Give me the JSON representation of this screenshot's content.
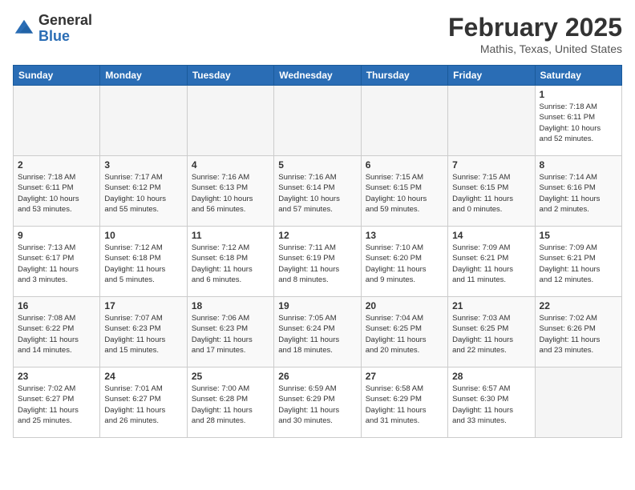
{
  "logo": {
    "general": "General",
    "blue": "Blue"
  },
  "title": "February 2025",
  "subtitle": "Mathis, Texas, United States",
  "weekdays": [
    "Sunday",
    "Monday",
    "Tuesday",
    "Wednesday",
    "Thursday",
    "Friday",
    "Saturday"
  ],
  "weeks": [
    [
      {
        "day": "",
        "info": ""
      },
      {
        "day": "",
        "info": ""
      },
      {
        "day": "",
        "info": ""
      },
      {
        "day": "",
        "info": ""
      },
      {
        "day": "",
        "info": ""
      },
      {
        "day": "",
        "info": ""
      },
      {
        "day": "1",
        "info": "Sunrise: 7:18 AM\nSunset: 6:11 PM\nDaylight: 10 hours\nand 52 minutes."
      }
    ],
    [
      {
        "day": "2",
        "info": "Sunrise: 7:18 AM\nSunset: 6:11 PM\nDaylight: 10 hours\nand 53 minutes."
      },
      {
        "day": "3",
        "info": "Sunrise: 7:17 AM\nSunset: 6:12 PM\nDaylight: 10 hours\nand 55 minutes."
      },
      {
        "day": "4",
        "info": "Sunrise: 7:16 AM\nSunset: 6:13 PM\nDaylight: 10 hours\nand 56 minutes."
      },
      {
        "day": "5",
        "info": "Sunrise: 7:16 AM\nSunset: 6:14 PM\nDaylight: 10 hours\nand 57 minutes."
      },
      {
        "day": "6",
        "info": "Sunrise: 7:15 AM\nSunset: 6:15 PM\nDaylight: 10 hours\nand 59 minutes."
      },
      {
        "day": "7",
        "info": "Sunrise: 7:15 AM\nSunset: 6:15 PM\nDaylight: 11 hours\nand 0 minutes."
      },
      {
        "day": "8",
        "info": "Sunrise: 7:14 AM\nSunset: 6:16 PM\nDaylight: 11 hours\nand 2 minutes."
      }
    ],
    [
      {
        "day": "9",
        "info": "Sunrise: 7:13 AM\nSunset: 6:17 PM\nDaylight: 11 hours\nand 3 minutes."
      },
      {
        "day": "10",
        "info": "Sunrise: 7:12 AM\nSunset: 6:18 PM\nDaylight: 11 hours\nand 5 minutes."
      },
      {
        "day": "11",
        "info": "Sunrise: 7:12 AM\nSunset: 6:18 PM\nDaylight: 11 hours\nand 6 minutes."
      },
      {
        "day": "12",
        "info": "Sunrise: 7:11 AM\nSunset: 6:19 PM\nDaylight: 11 hours\nand 8 minutes."
      },
      {
        "day": "13",
        "info": "Sunrise: 7:10 AM\nSunset: 6:20 PM\nDaylight: 11 hours\nand 9 minutes."
      },
      {
        "day": "14",
        "info": "Sunrise: 7:09 AM\nSunset: 6:21 PM\nDaylight: 11 hours\nand 11 minutes."
      },
      {
        "day": "15",
        "info": "Sunrise: 7:09 AM\nSunset: 6:21 PM\nDaylight: 11 hours\nand 12 minutes."
      }
    ],
    [
      {
        "day": "16",
        "info": "Sunrise: 7:08 AM\nSunset: 6:22 PM\nDaylight: 11 hours\nand 14 minutes."
      },
      {
        "day": "17",
        "info": "Sunrise: 7:07 AM\nSunset: 6:23 PM\nDaylight: 11 hours\nand 15 minutes."
      },
      {
        "day": "18",
        "info": "Sunrise: 7:06 AM\nSunset: 6:23 PM\nDaylight: 11 hours\nand 17 minutes."
      },
      {
        "day": "19",
        "info": "Sunrise: 7:05 AM\nSunset: 6:24 PM\nDaylight: 11 hours\nand 18 minutes."
      },
      {
        "day": "20",
        "info": "Sunrise: 7:04 AM\nSunset: 6:25 PM\nDaylight: 11 hours\nand 20 minutes."
      },
      {
        "day": "21",
        "info": "Sunrise: 7:03 AM\nSunset: 6:25 PM\nDaylight: 11 hours\nand 22 minutes."
      },
      {
        "day": "22",
        "info": "Sunrise: 7:02 AM\nSunset: 6:26 PM\nDaylight: 11 hours\nand 23 minutes."
      }
    ],
    [
      {
        "day": "23",
        "info": "Sunrise: 7:02 AM\nSunset: 6:27 PM\nDaylight: 11 hours\nand 25 minutes."
      },
      {
        "day": "24",
        "info": "Sunrise: 7:01 AM\nSunset: 6:27 PM\nDaylight: 11 hours\nand 26 minutes."
      },
      {
        "day": "25",
        "info": "Sunrise: 7:00 AM\nSunset: 6:28 PM\nDaylight: 11 hours\nand 28 minutes."
      },
      {
        "day": "26",
        "info": "Sunrise: 6:59 AM\nSunset: 6:29 PM\nDaylight: 11 hours\nand 30 minutes."
      },
      {
        "day": "27",
        "info": "Sunrise: 6:58 AM\nSunset: 6:29 PM\nDaylight: 11 hours\nand 31 minutes."
      },
      {
        "day": "28",
        "info": "Sunrise: 6:57 AM\nSunset: 6:30 PM\nDaylight: 11 hours\nand 33 minutes."
      },
      {
        "day": "",
        "info": ""
      }
    ]
  ]
}
